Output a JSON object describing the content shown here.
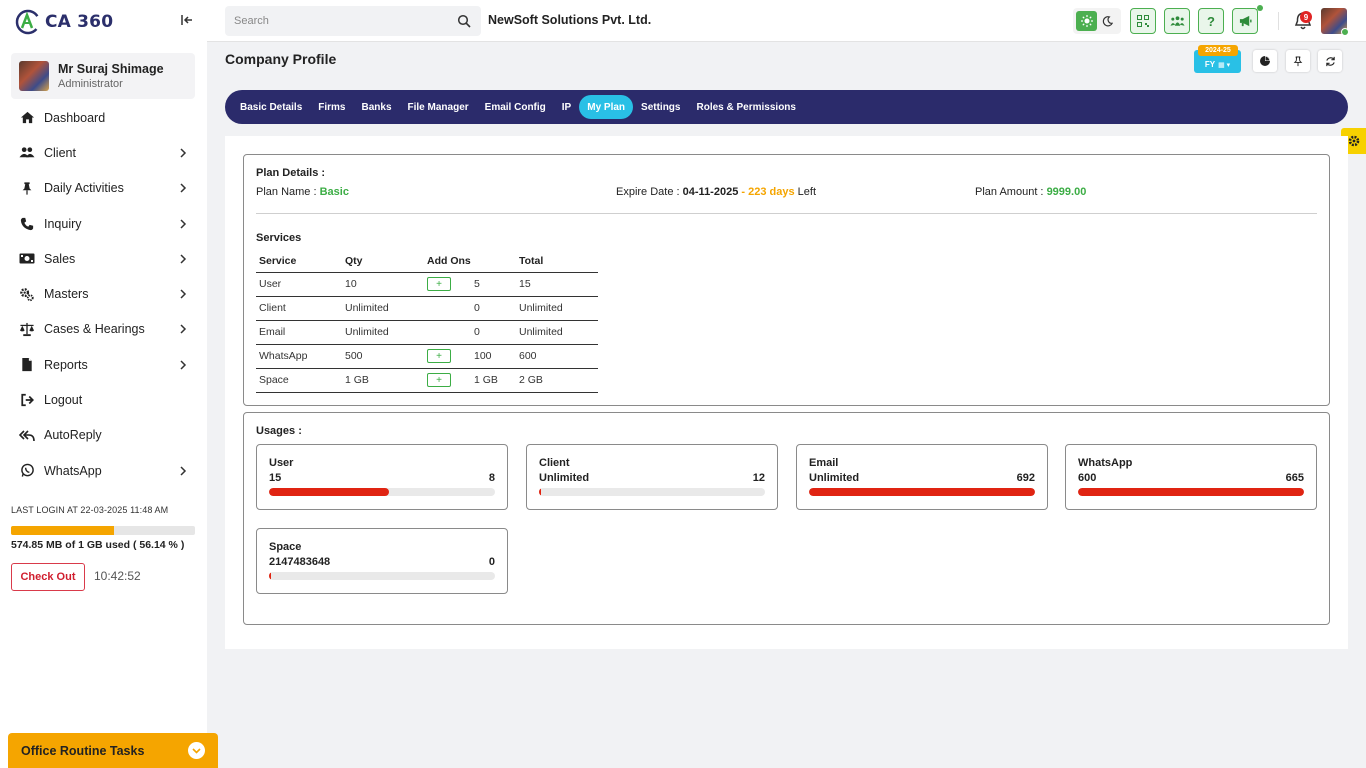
{
  "app": {
    "name": "CA 360"
  },
  "user": {
    "name": "Mr Suraj Shimage",
    "role": "Administrator"
  },
  "sidebar": {
    "items": [
      {
        "label": "Dashboard",
        "icon": "home-icon",
        "has_children": false
      },
      {
        "label": "Client",
        "icon": "users-icon",
        "has_children": true
      },
      {
        "label": "Daily Activities",
        "icon": "pin-icon",
        "has_children": true
      },
      {
        "label": "Inquiry",
        "icon": "phone-icon",
        "has_children": true
      },
      {
        "label": "Sales",
        "icon": "money-icon",
        "has_children": true
      },
      {
        "label": "Masters",
        "icon": "gears-icon",
        "has_children": true
      },
      {
        "label": "Cases & Hearings",
        "icon": "scale-icon",
        "has_children": true
      },
      {
        "label": "Reports",
        "icon": "document-icon",
        "has_children": true
      },
      {
        "label": "Logout",
        "icon": "logout-icon",
        "has_children": false
      },
      {
        "label": "AutoReply",
        "icon": "reply-all-icon",
        "has_children": false
      },
      {
        "label": "WhatsApp",
        "icon": "whatsapp-icon",
        "has_children": true
      }
    ],
    "last_login": "LAST LOGIN AT 22-03-2025 11:48 AM",
    "storage": {
      "text": "574.85 MB of 1 GB used ( 56.14 % )",
      "percent": 56.14
    },
    "checkout_label": "Check Out",
    "clock": "10:42:52",
    "routine_label": "Office Routine Tasks"
  },
  "topbar": {
    "search_placeholder": "Search",
    "company": "NewSoft Solutions Pvt. Ltd.",
    "notification_count": "9"
  },
  "page": {
    "title": "Company Profile",
    "fy_label": "FY",
    "fy_year": "2024-25"
  },
  "tabs": [
    {
      "label": "Basic Details",
      "active": false
    },
    {
      "label": "Firms",
      "active": false
    },
    {
      "label": "Banks",
      "active": false
    },
    {
      "label": "File Manager",
      "active": false
    },
    {
      "label": "Email Config",
      "active": false
    },
    {
      "label": "IP",
      "active": false
    },
    {
      "label": "My Plan",
      "active": true
    },
    {
      "label": "Settings",
      "active": false
    },
    {
      "label": "Roles & Permissions",
      "active": false
    }
  ],
  "plan": {
    "heading": "Plan Details :",
    "name_label": "Plan Name :",
    "name": "Basic",
    "expire_label": "Expire Date :",
    "expire_date": "04-11-2025",
    "days_sep": " - ",
    "days": "223 days",
    "days_suffix": "Left",
    "amount_label": "Plan Amount :",
    "amount": "9999.00"
  },
  "services": {
    "heading": "Services",
    "columns": [
      "Service",
      "Qty",
      "Add Ons",
      "Total"
    ],
    "rows": [
      {
        "service": "User",
        "qty": "10",
        "addon_button": true,
        "addon": "5",
        "total": "15"
      },
      {
        "service": "Client",
        "qty": "Unlimited",
        "addon_button": false,
        "addon": "0",
        "total": "Unlimited"
      },
      {
        "service": "Email",
        "qty": "Unlimited",
        "addon_button": false,
        "addon": "0",
        "total": "Unlimited"
      },
      {
        "service": "WhatsApp",
        "qty": "500",
        "addon_button": true,
        "addon": "100",
        "total": "600"
      },
      {
        "service": "Space",
        "qty": "1 GB",
        "addon_button": true,
        "addon": "1 GB",
        "total": "2 GB"
      }
    ],
    "add_symbol": "+"
  },
  "usages": {
    "heading": "Usages :",
    "cards": [
      {
        "name": "User",
        "limit": "15",
        "used": "8",
        "fill_percent": 53
      },
      {
        "name": "Client",
        "limit": "Unlimited",
        "used": "12",
        "fill_percent": 1
      },
      {
        "name": "Email",
        "limit": "Unlimited",
        "used": "692",
        "fill_percent": 100
      },
      {
        "name": "WhatsApp",
        "limit": "600",
        "used": "665",
        "fill_percent": 100
      },
      {
        "name": "Space",
        "limit": "2147483648",
        "used": "0",
        "fill_percent": 1
      }
    ]
  },
  "colors": {
    "primary_nav": "#2b2b6b",
    "accent": "#29c0e6",
    "success": "#3cad45",
    "warning": "#f5a500",
    "danger": "#e02412"
  }
}
